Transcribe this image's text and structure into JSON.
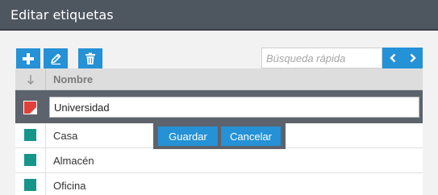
{
  "window": {
    "title": "Editar etiquetas"
  },
  "toolbar": {
    "add_icon": "plus-icon",
    "edit_icon": "pencil-icon",
    "delete_icon": "trash-icon"
  },
  "search": {
    "placeholder": "Búsqueda rápida"
  },
  "pager": {
    "prev_icon": "chevron-left-icon",
    "next_icon": "chevron-right-icon"
  },
  "table": {
    "sort_icon": "arrow-down-icon",
    "column_name": "Nombre",
    "editing": {
      "value": "Universidad",
      "color": "#e2413b"
    },
    "rows": [
      {
        "label": "Casa",
        "color": "#16968a"
      },
      {
        "label": "Almacén",
        "color": "#16968a"
      },
      {
        "label": "Oficina",
        "color": "#16968a"
      }
    ]
  },
  "actions": {
    "save_label": "Guardar",
    "cancel_label": "Cancelar"
  },
  "colors": {
    "accent": "#2591d6",
    "titlebar": "#4e5660",
    "edit_bg": "#5c636c"
  }
}
